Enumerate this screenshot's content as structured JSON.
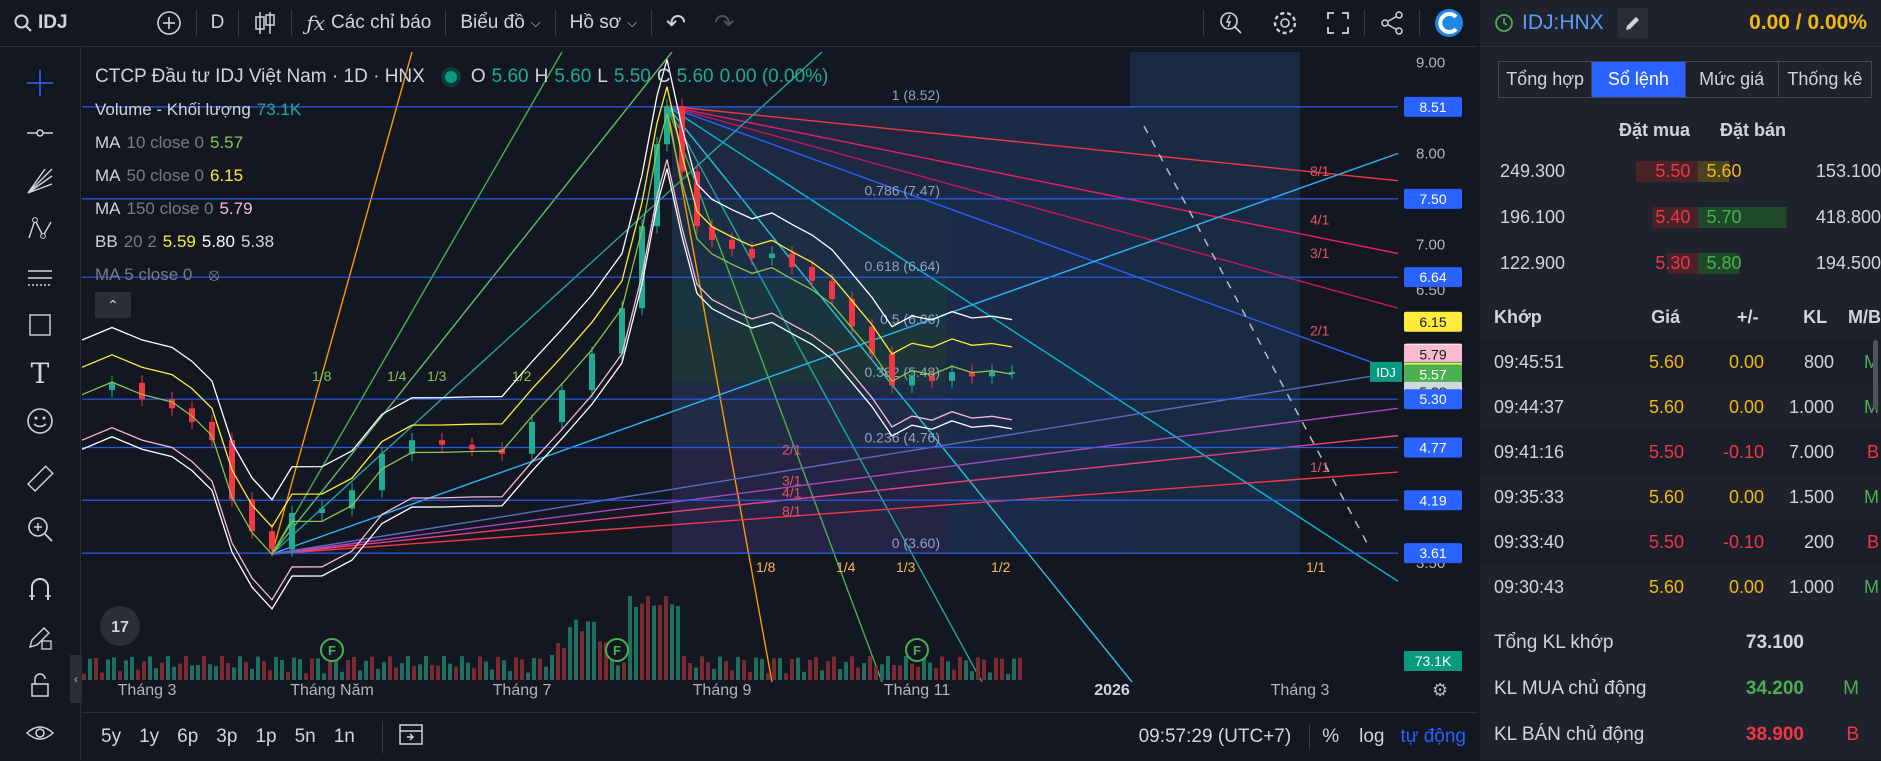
{
  "topbar": {
    "symbol": "IDJ",
    "interval": "D",
    "indicators_label": "Các chỉ báo",
    "chart_type_label": "Biểu đồ",
    "profile_label": "Hồ sơ"
  },
  "legend": {
    "title": "CTCP Đầu tư IDJ Việt Nam · 1D · HNX",
    "o_label": "O",
    "o_val": "5.60",
    "h_label": "H",
    "h_val": "5.60",
    "l_label": "L",
    "l_val": "5.50",
    "c_label": "C",
    "c_val": "5.60",
    "change": "0.00 (0.00%)",
    "volume_label": "Volume - Khối lượng",
    "volume_val": "73.1K",
    "ma10_label": "MA",
    "ma10_params": "10 close 0",
    "ma10_val": "5.57",
    "ma50_label": "MA",
    "ma50_params": "50 close 0",
    "ma50_val": "6.15",
    "ma150_label": "MA",
    "ma150_params": "150 close 0",
    "ma150_val": "5.79",
    "bb_label": "BB",
    "bb_params": "20 2",
    "bb_v1": "5.59",
    "bb_v2": "5.80",
    "bb_v3": "5.38",
    "ma5_label": "MA 5 close 0"
  },
  "chart": {
    "fib_labels": [
      {
        "text": "1 (8.52)",
        "price": 8.52
      },
      {
        "text": "0.786 (7.47)",
        "price": 7.47
      },
      {
        "text": "0.618 (6.64)",
        "price": 6.64
      },
      {
        "text": "0.5 (6.06)",
        "price": 6.06
      },
      {
        "text": "0.382 (5.48)",
        "price": 5.48
      },
      {
        "text": "0.236 (4.76)",
        "price": 4.76
      },
      {
        "text": "0 (3.60)",
        "price": 3.6
      }
    ],
    "fan_ratios_top": [
      "8/1",
      "4/1",
      "3/1",
      "2/1",
      "1/1"
    ],
    "fan_ratios_bottom": [
      "2/1",
      "3/1",
      "4/1",
      "8/1"
    ],
    "fan_ratios_left": [
      "1/8",
      "1/4",
      "1/3",
      "1/2"
    ],
    "fan_ratios_base": [
      "1/8",
      "1/4",
      "1/3",
      "1/2",
      "1/1"
    ],
    "event_marker": "F",
    "price_axis": [
      "9.00",
      "8.00",
      "7.00",
      "6.50",
      "5.50",
      "3.50"
    ],
    "price_tags": [
      {
        "text": "8.51",
        "color": "#2962ff",
        "price": 8.51
      },
      {
        "text": "7.50",
        "color": "#2962ff",
        "price": 7.5
      },
      {
        "text": "6.64",
        "color": "#2962ff",
        "price": 6.64
      },
      {
        "text": "6.15",
        "color": "#ffeb3b",
        "price": 6.15
      },
      {
        "text": "5.80",
        "color": "#ffffff",
        "price": 5.8
      },
      {
        "text": "5.79",
        "color": "#f8bbd0",
        "price": 5.79
      },
      {
        "text": "5.60",
        "color": "#089981",
        "price": 5.6
      },
      {
        "text": "5.59",
        "color": "#ffeb3b",
        "price": 5.59
      },
      {
        "text": "5.57",
        "color": "#4caf50",
        "price": 5.57
      },
      {
        "text": "5.38",
        "color": "#cfd8dc",
        "price": 5.38
      },
      {
        "text": "5.30",
        "color": "#2962ff",
        "price": 5.3
      },
      {
        "text": "4.77",
        "color": "#2962ff",
        "price": 4.77
      },
      {
        "text": "4.19",
        "color": "#2962ff",
        "price": 4.19
      },
      {
        "text": "3.61",
        "color": "#2962ff",
        "price": 3.61
      }
    ],
    "symbol_tag": "IDJ",
    "volume_tag": "73.1K",
    "time_axis": [
      "Tháng 3",
      "Tháng Năm",
      "Tháng 7",
      "Tháng 9",
      "Tháng 11",
      "2026",
      "Tháng 3"
    ]
  },
  "bottom": {
    "ranges": [
      "5y",
      "1y",
      "6p",
      "3p",
      "1p",
      "5n",
      "1n"
    ],
    "clock": "09:57:29 (UTC+7)",
    "pct": "%",
    "log": "log",
    "auto": "tự động"
  },
  "panel": {
    "symbol": "IDJ:HNX",
    "price_change": "0.00 / 0.00%",
    "tabs": [
      "Tổng hợp",
      "Sổ lệnh",
      "Mức giá",
      "Thống kê"
    ],
    "active_tab": 1,
    "ob_headers": {
      "bid": "Đặt mua",
      "ask": "Đặt bán"
    },
    "orderbook": [
      {
        "bid_vol": "249.300",
        "bid": "5.50",
        "ask": "5.60",
        "ask_vol": "153.100"
      },
      {
        "bid_vol": "196.100",
        "bid": "5.40",
        "ask": "5.70",
        "ask_vol": "418.800"
      },
      {
        "bid_vol": "122.900",
        "bid": "5.30",
        "ask": "5.80",
        "ask_vol": "194.500"
      }
    ],
    "match_headers": [
      "Khớp",
      "Giá",
      "+/-",
      "KL",
      "M/B"
    ],
    "matches": [
      {
        "time": "09:45:51",
        "price": "5.60",
        "chg": "0.00",
        "vol": "800",
        "side": "M"
      },
      {
        "time": "09:44:37",
        "price": "5.60",
        "chg": "0.00",
        "vol": "1.000",
        "side": "M"
      },
      {
        "time": "09:41:16",
        "price": "5.50",
        "chg": "-0.10",
        "vol": "7.000",
        "side": "B"
      },
      {
        "time": "09:35:33",
        "price": "5.60",
        "chg": "0.00",
        "vol": "1.500",
        "side": "M"
      },
      {
        "time": "09:33:40",
        "price": "5.50",
        "chg": "-0.10",
        "vol": "200",
        "side": "B"
      },
      {
        "time": "09:30:43",
        "price": "5.60",
        "chg": "0.00",
        "vol": "1.000",
        "side": "M"
      }
    ],
    "summary": [
      {
        "label": "Tổng KL khớp",
        "value": "73.100",
        "tag": ""
      },
      {
        "label": "KL MUA chủ động",
        "value": "34.200",
        "tag": "M"
      },
      {
        "label": "KL BÁN chủ động",
        "value": "38.900",
        "tag": "B"
      }
    ]
  }
}
